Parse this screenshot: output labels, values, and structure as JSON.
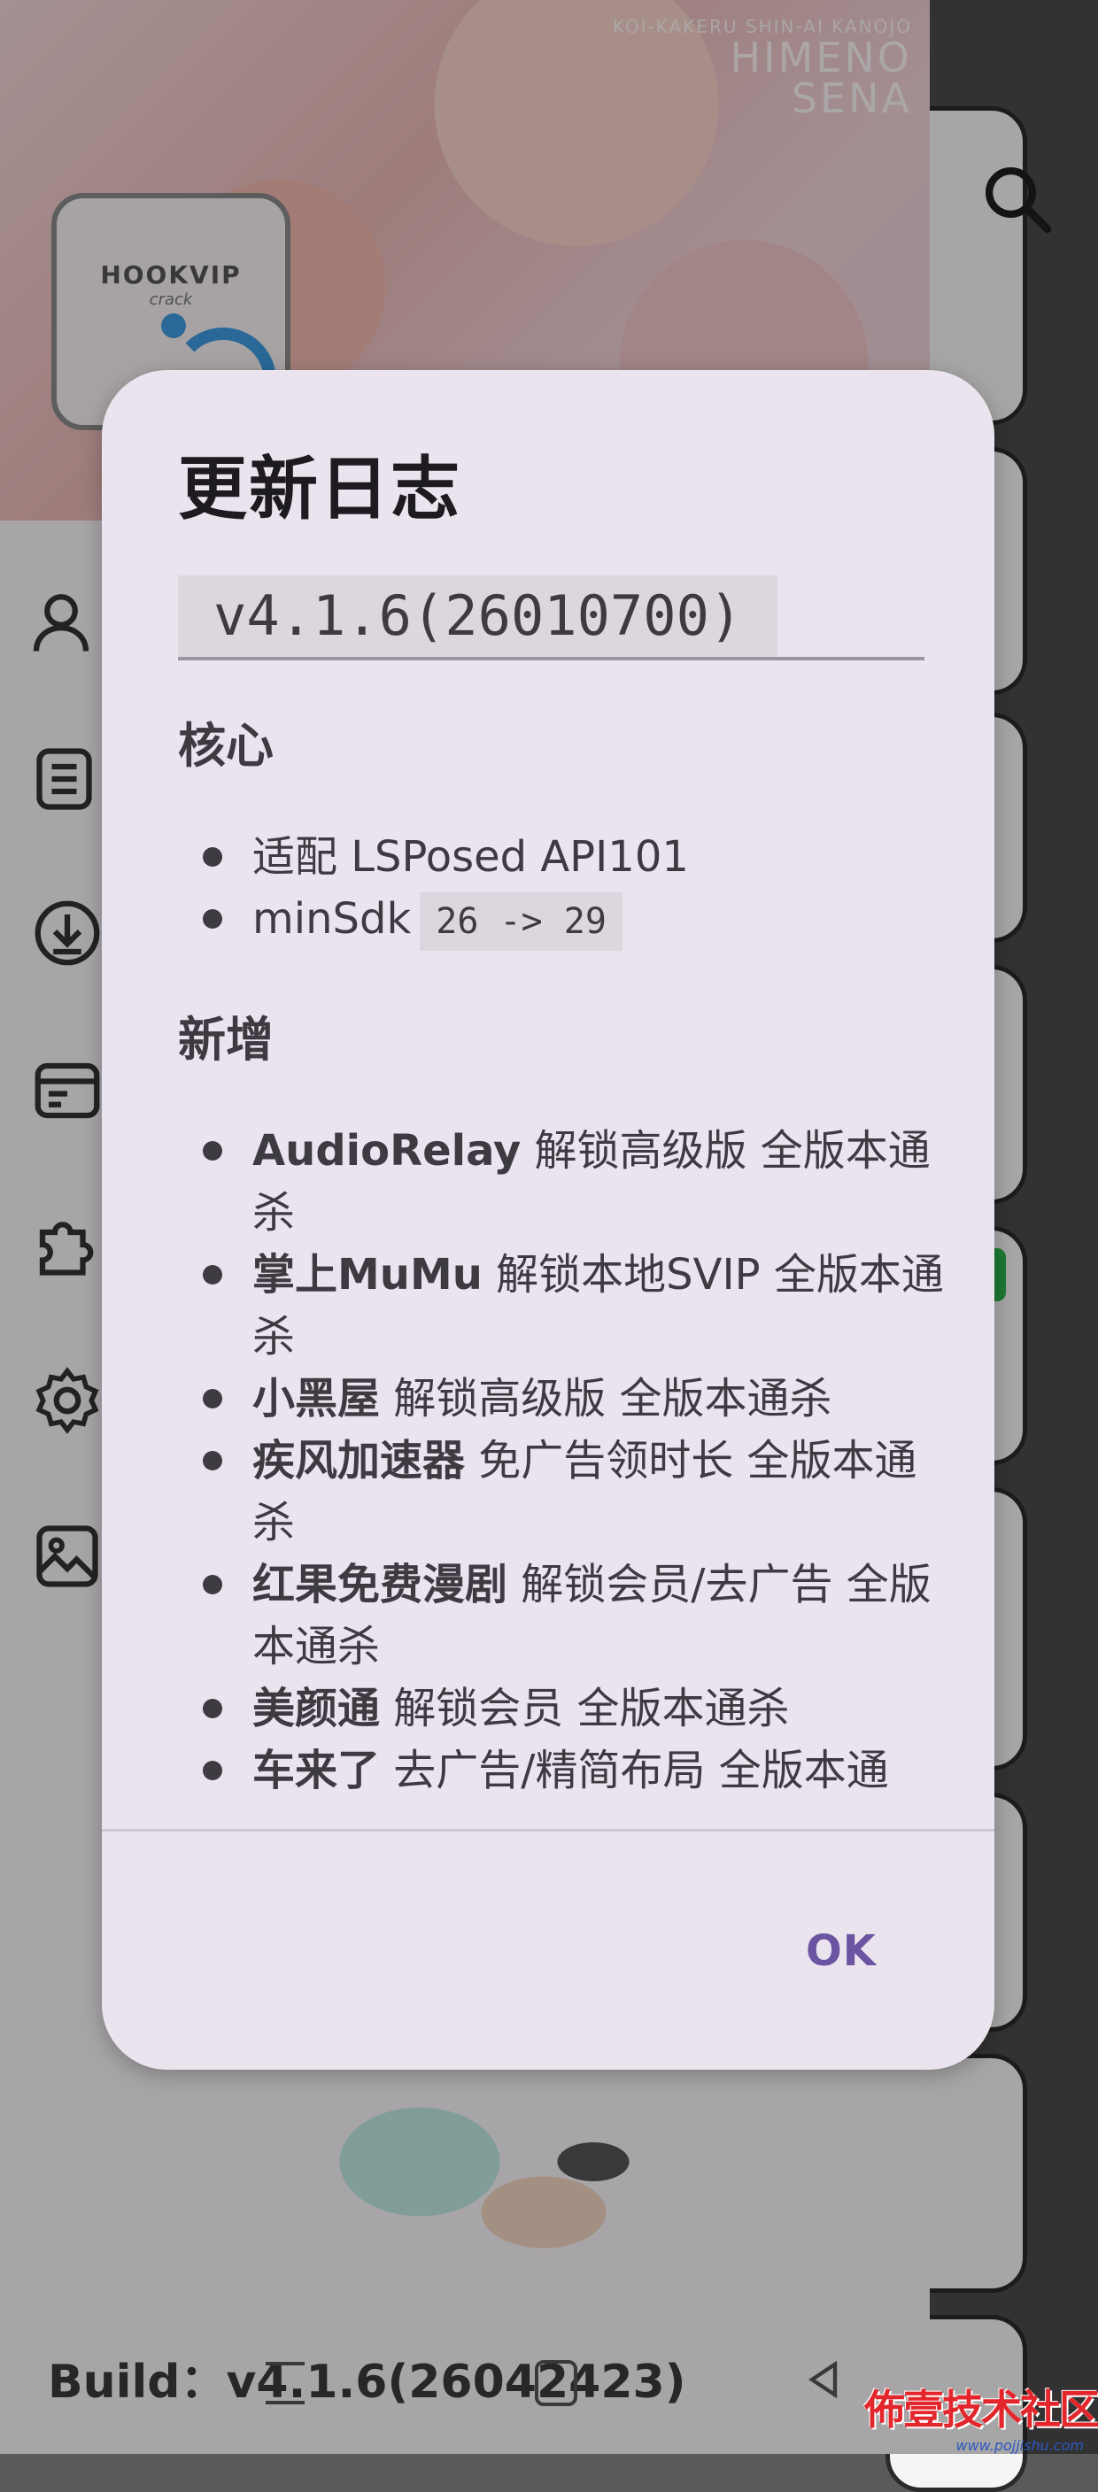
{
  "banner": {
    "title_small": "KOI-KAKERU SHIN-AI KANOJO",
    "title_big_1": "HIMENO",
    "title_big_2": "SENA"
  },
  "app_logo": {
    "name": "HOOKVIP",
    "sub": "crack"
  },
  "drawer": {
    "icons": [
      "user-icon",
      "list-icon",
      "download-icon",
      "window-icon",
      "puzzle-icon",
      "settings-icon",
      "image-icon"
    ],
    "build_label": "Build：v4.1.6(26042423)"
  },
  "dialog": {
    "title": "更新日志",
    "version": "v4.1.6(26010700)",
    "sections": [
      {
        "title": "核心",
        "items": [
          {
            "bold": "",
            "text": "适配 LSPosed API101",
            "code": ""
          },
          {
            "bold": "",
            "text": "minSdk",
            "code": "26 -> 29"
          }
        ]
      },
      {
        "title": "新增",
        "items": [
          {
            "bold": "AudioRelay",
            "text": " 解锁高级版 全版本通杀",
            "code": ""
          },
          {
            "bold": "掌上MuMu",
            "text": " 解锁本地SVIP 全版本通杀",
            "code": ""
          },
          {
            "bold": "小黑屋",
            "text": " 解锁高级版 全版本通杀",
            "code": ""
          },
          {
            "bold": "疾风加速器",
            "text": " 免广告领时长 全版本通杀",
            "code": ""
          },
          {
            "bold": "红果免费漫剧",
            "text": " 解锁会员/去广告 全版本通杀",
            "code": ""
          },
          {
            "bold": "美颜通",
            "text": " 解锁会员 全版本通杀",
            "code": ""
          },
          {
            "bold": "车来了",
            "text": " 去广告/精简布局 全版本通",
            "code": ""
          }
        ]
      }
    ],
    "ok_label": "OK"
  },
  "watermark": {
    "main": "佈壹技术社区",
    "url": "www.pojjishu.com"
  },
  "colors": {
    "accent": "#6a55a3",
    "dialog_bg": "#ebe4ee",
    "code_bg": "#dcd6df"
  }
}
